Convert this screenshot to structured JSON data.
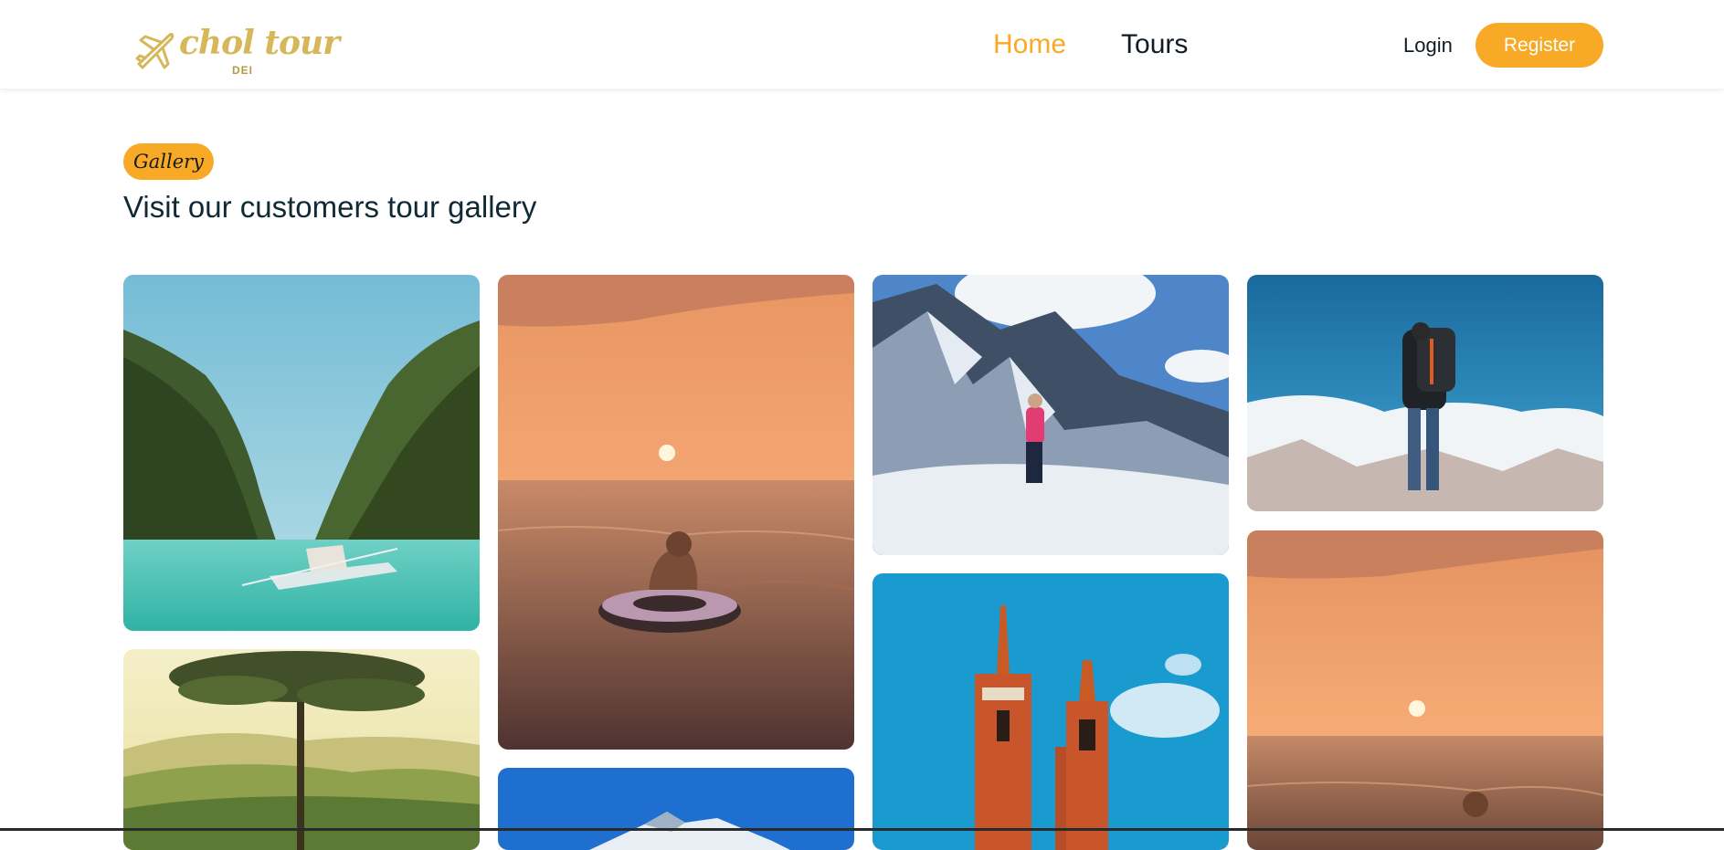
{
  "brand": {
    "name": "chol tour",
    "sub": "DEI",
    "color": "#d6b75a"
  },
  "nav": {
    "items": [
      {
        "label": "Home",
        "active": true
      },
      {
        "label": "Tours",
        "active": false
      }
    ]
  },
  "auth": {
    "login_label": "Login",
    "register_label": "Register"
  },
  "gallery": {
    "badge": "Gallery",
    "title": "Visit our customers tour gallery",
    "images": [
      {
        "subject": "lagoon-boat-cliffs"
      },
      {
        "subject": "sunset-swimmer-float"
      },
      {
        "subject": "mountain-hiker-snow"
      },
      {
        "subject": "backpacker-clouds"
      },
      {
        "subject": "tree-misty-valley"
      },
      {
        "subject": "blue-sky-mountain"
      },
      {
        "subject": "brick-church-towers"
      },
      {
        "subject": "sunset-ocean"
      }
    ]
  },
  "colors": {
    "accent": "#f8a926",
    "text_dark": "#111b24",
    "title": "#0f2a36"
  }
}
